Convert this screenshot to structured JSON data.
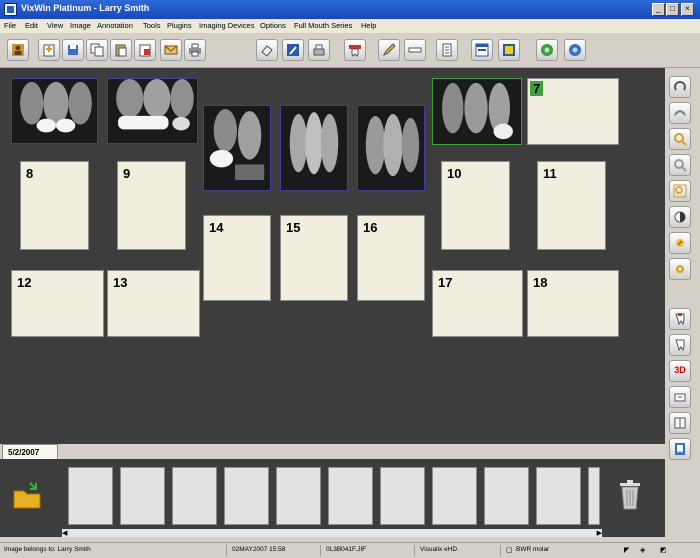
{
  "window": {
    "title": "VixWin Platinum - Larry Smith"
  },
  "menu": [
    "File",
    "Edit",
    "View",
    "Image",
    "Annotation",
    "Tools",
    "Plugins",
    "Imaging Devices",
    "Options",
    "Full Mouth Series",
    "Help"
  ],
  "slots": [
    {
      "label": "7"
    },
    {
      "label": "8"
    },
    {
      "label": "9"
    },
    {
      "label": "10"
    },
    {
      "label": "11"
    },
    {
      "label": "12"
    },
    {
      "label": "13"
    },
    {
      "label": "14"
    },
    {
      "label": "15"
    },
    {
      "label": "16"
    },
    {
      "label": "17"
    },
    {
      "label": "18"
    }
  ],
  "side_3d_label": "3D",
  "date_tab": "5/2/2007",
  "status": {
    "owner": "Image belongs to: Larry Smith",
    "date": "02MAY2007 15:58",
    "file": "0L3B041F.JIF",
    "device": "Visualix eHD",
    "desc": "BWR molar"
  },
  "colors": {
    "canvas": "#3d3d3d",
    "slot": "#f1eee0",
    "selected": "#3da33d",
    "titlebar": "#1f55c6"
  }
}
